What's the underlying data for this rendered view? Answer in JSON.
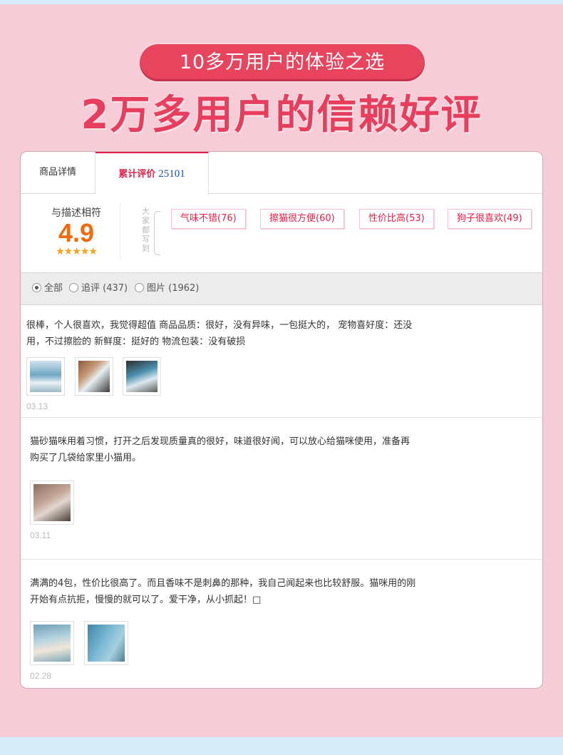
{
  "banner": {
    "pill_text": "10多万用户的体验之选",
    "headline": "2万多用户的信赖好评"
  },
  "tabs": {
    "detail_label": "商品详情",
    "reviews_label": "累计评价",
    "reviews_count": "25101"
  },
  "summary": {
    "score_label": "与描述相符",
    "score": "4.9",
    "stars": "★★★★★",
    "vertical_label": "大家都写到",
    "tags": [
      "气味不错(76)",
      "擦猫很方便(60)",
      "性价比高(53)",
      "狗子很喜欢(49)"
    ]
  },
  "filter": {
    "all": "全部",
    "followup": "追评 (437)",
    "images": "图片 (1962)",
    "selected": "全部"
  },
  "reviews": [
    {
      "text_line1": "很棒，个人很喜欢，我觉得超值 商品品质：很好，没有异味，一包挺大的， 宠物喜好度：还没",
      "text_line2": "用，不过擦脸的 新鲜度：挺好的 物流包装：没有破损",
      "date": "03.13"
    },
    {
      "text_line1": "猫砂猫咪用着习惯，打开之后发现质量真的很好，味道很好闻，可以放心给猫咪使用，准备再",
      "text_line2": "购买了几袋给家里小猫用。",
      "date": "03.11"
    },
    {
      "text_line1": "满满的4包，性价比很高了。而且香味不是刺鼻的那种，我自己闻起来也比较舒服。猫咪用的刚",
      "text_line2": "开始有点抗拒，慢慢的就可以了。爱干净，从小抓起！□",
      "date": "02.28"
    }
  ],
  "colors": {
    "background": "#f6ccd7",
    "accent": "#e2214a",
    "score": "#f06a0f",
    "star": "#f7a21b",
    "count": "#1e4ea8"
  }
}
